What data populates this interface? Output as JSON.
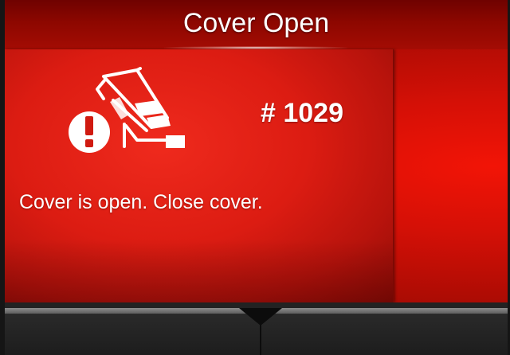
{
  "header": {
    "title": "Cover Open"
  },
  "error": {
    "code": "# 1029",
    "message": "Cover is open. Close cover.",
    "icon": "printer-cover-open-warning-icon"
  },
  "colors": {
    "title_bar": "#8d0700",
    "panel": "#dc1c12",
    "background_glow": "#f21406",
    "text": "#ffffff",
    "bottom_bar": "#222222"
  }
}
